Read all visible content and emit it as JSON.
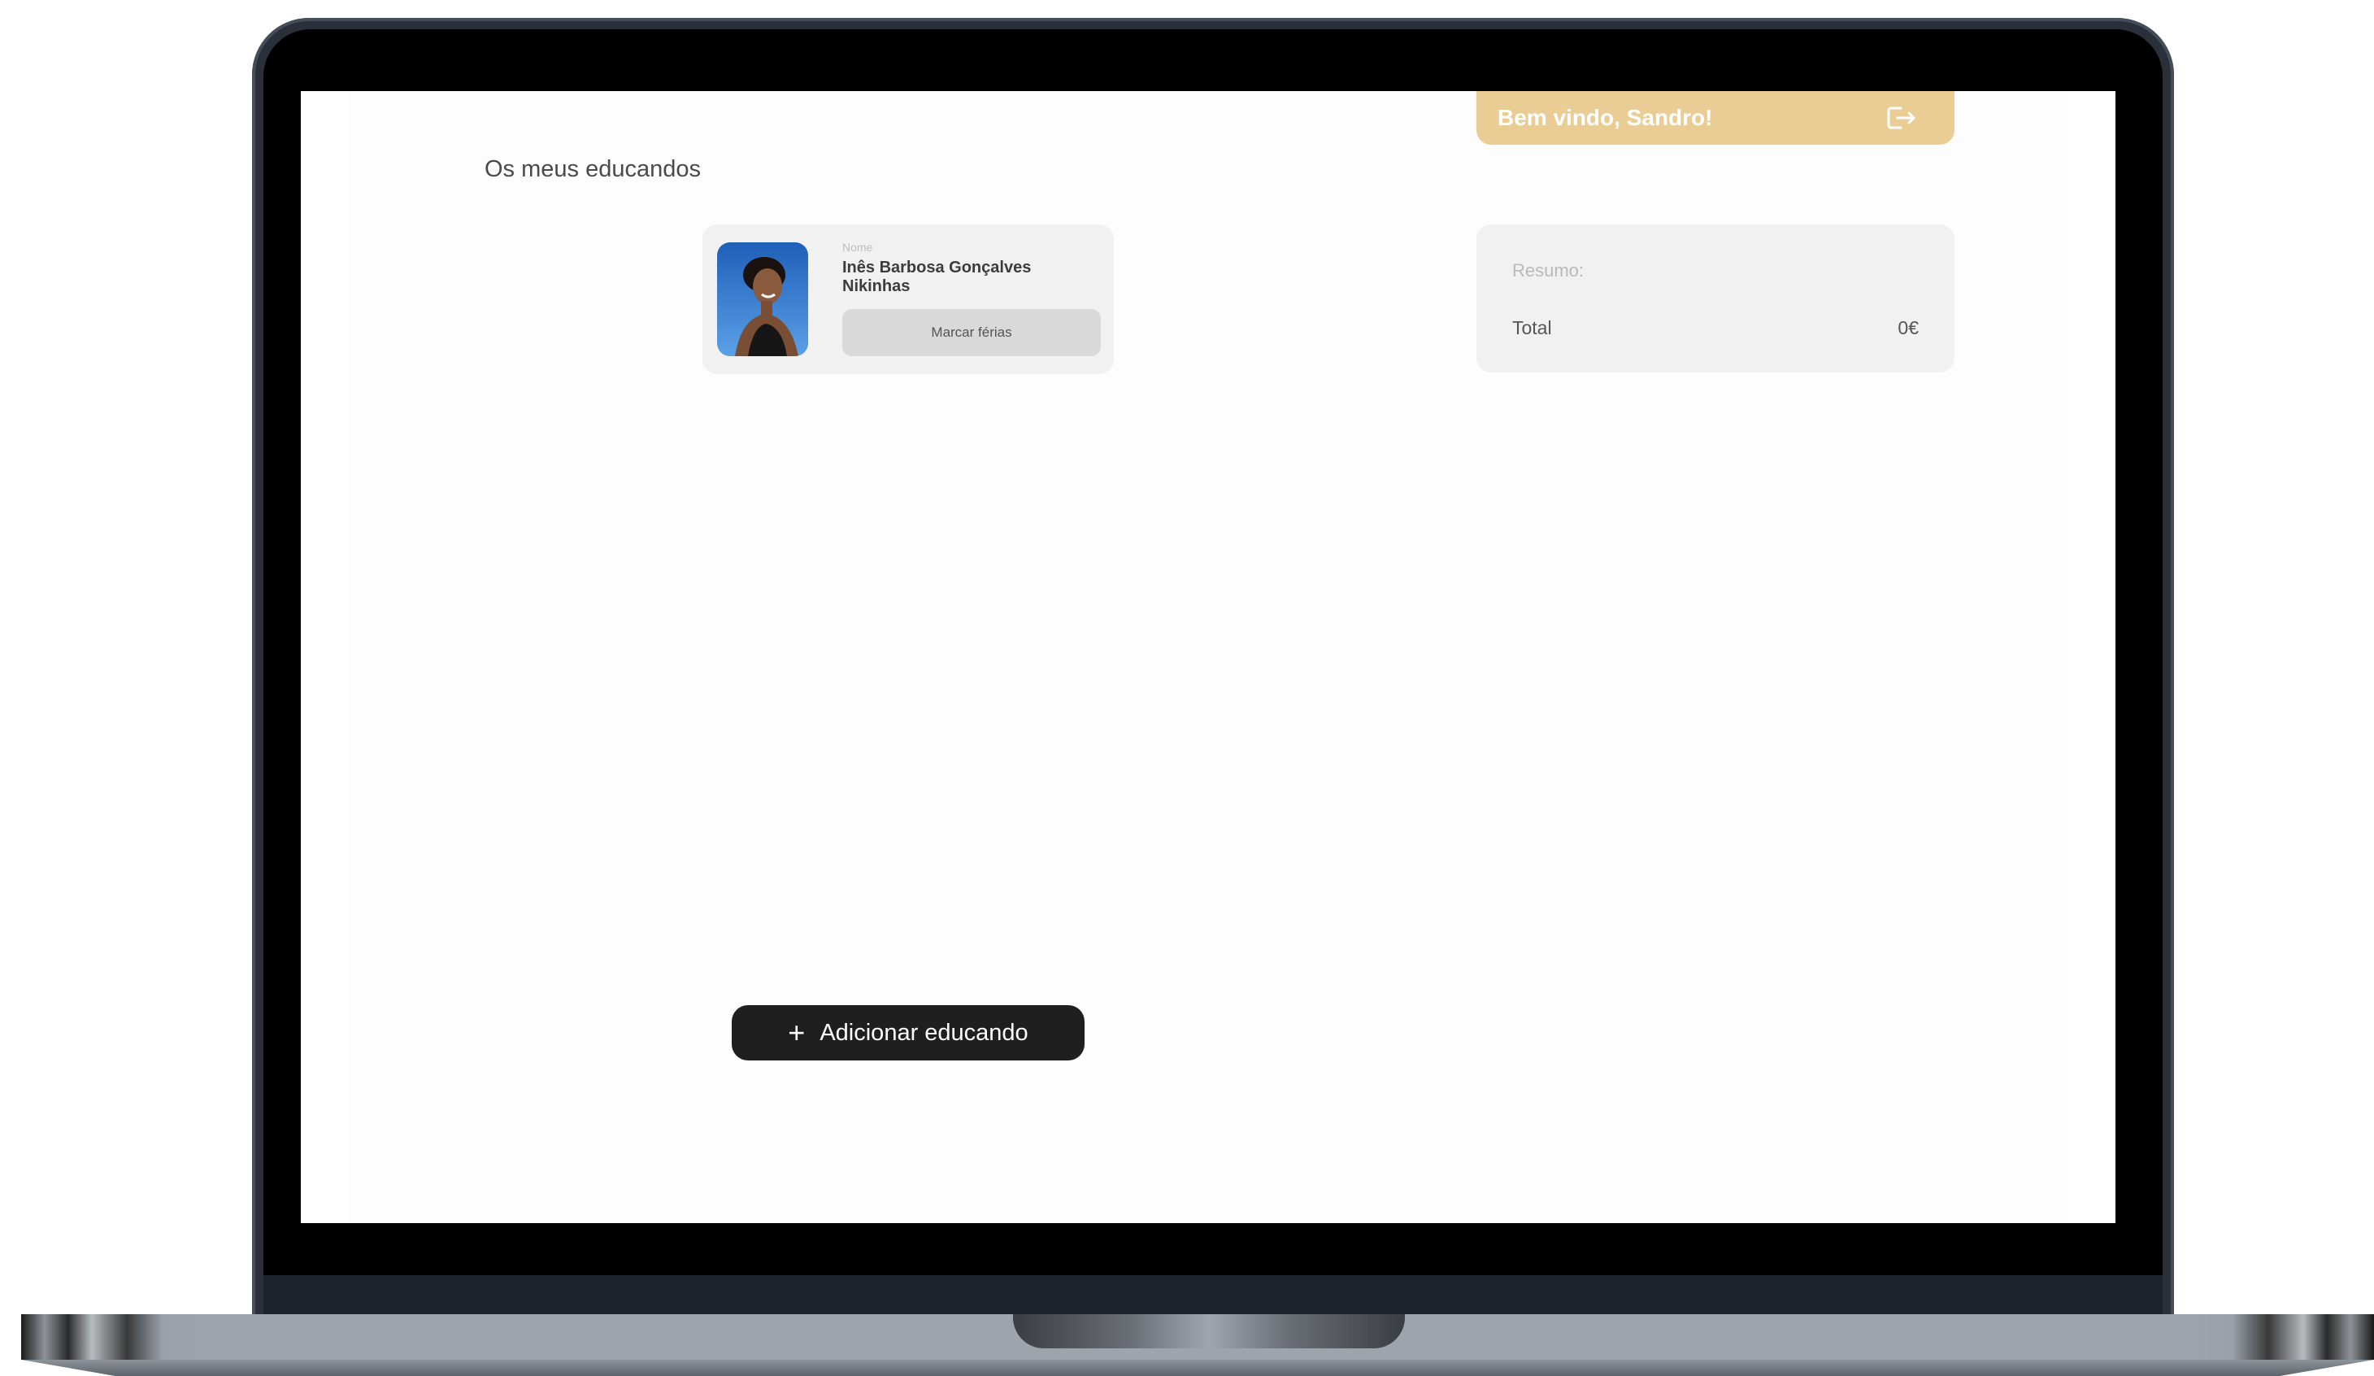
{
  "header": {
    "welcome_text": "Bem vindo, Sandro!",
    "logout_icon": "logout-icon",
    "accent_color": "#e9cd95"
  },
  "main": {
    "title": "Os meus educandos",
    "students": [
      {
        "name_label": "Nome",
        "name": "Inês Barbosa Gonçalves Nikinhas",
        "vacation_button": "Marcar férias",
        "avatar_icon": "student-photo"
      }
    ],
    "add_button": {
      "icon": "plus",
      "label": "Adicionar educando"
    }
  },
  "summary": {
    "title": "Resumo:",
    "total_label": "Total",
    "total_value": "0€"
  }
}
